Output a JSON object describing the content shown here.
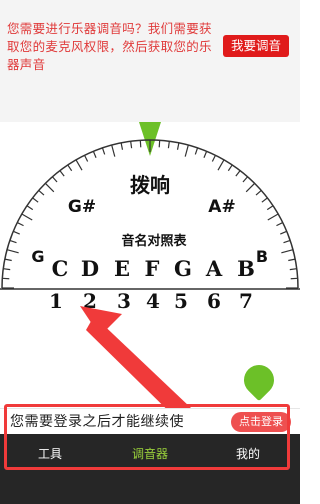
{
  "banner": {
    "message": "您需要进行乐器调音吗？我们需要获取您的麦克风权限，然后获取您的乐器声音",
    "button_label": "我要调音"
  },
  "tuner": {
    "pluck_label": "拨响",
    "sharp_left": "G#",
    "sharp_right": "A#",
    "left_note": "G",
    "right_note": "B",
    "chart_title": "音名对照表",
    "note_names": [
      "C",
      "D",
      "E",
      "F",
      "G",
      "A",
      "B"
    ],
    "numbers": [
      "1",
      "2",
      "3",
      "4",
      "5",
      "6",
      "7"
    ],
    "pointer_color": "#6cc028"
  },
  "login": {
    "message": "您需要登录之后才能继续使",
    "button_label": "点击登录"
  },
  "tabs": [
    {
      "label": "工具",
      "active": false
    },
    {
      "label": "调音器",
      "active": true
    },
    {
      "label": "我的",
      "active": false
    }
  ],
  "colors": {
    "accent_red": "#e01b1b",
    "active_tab": "#9bd23b",
    "fab_green": "#6cc028"
  },
  "icons": {
    "pointer": "triangle-pointer-icon",
    "fab": "chat-bubble-icon"
  }
}
